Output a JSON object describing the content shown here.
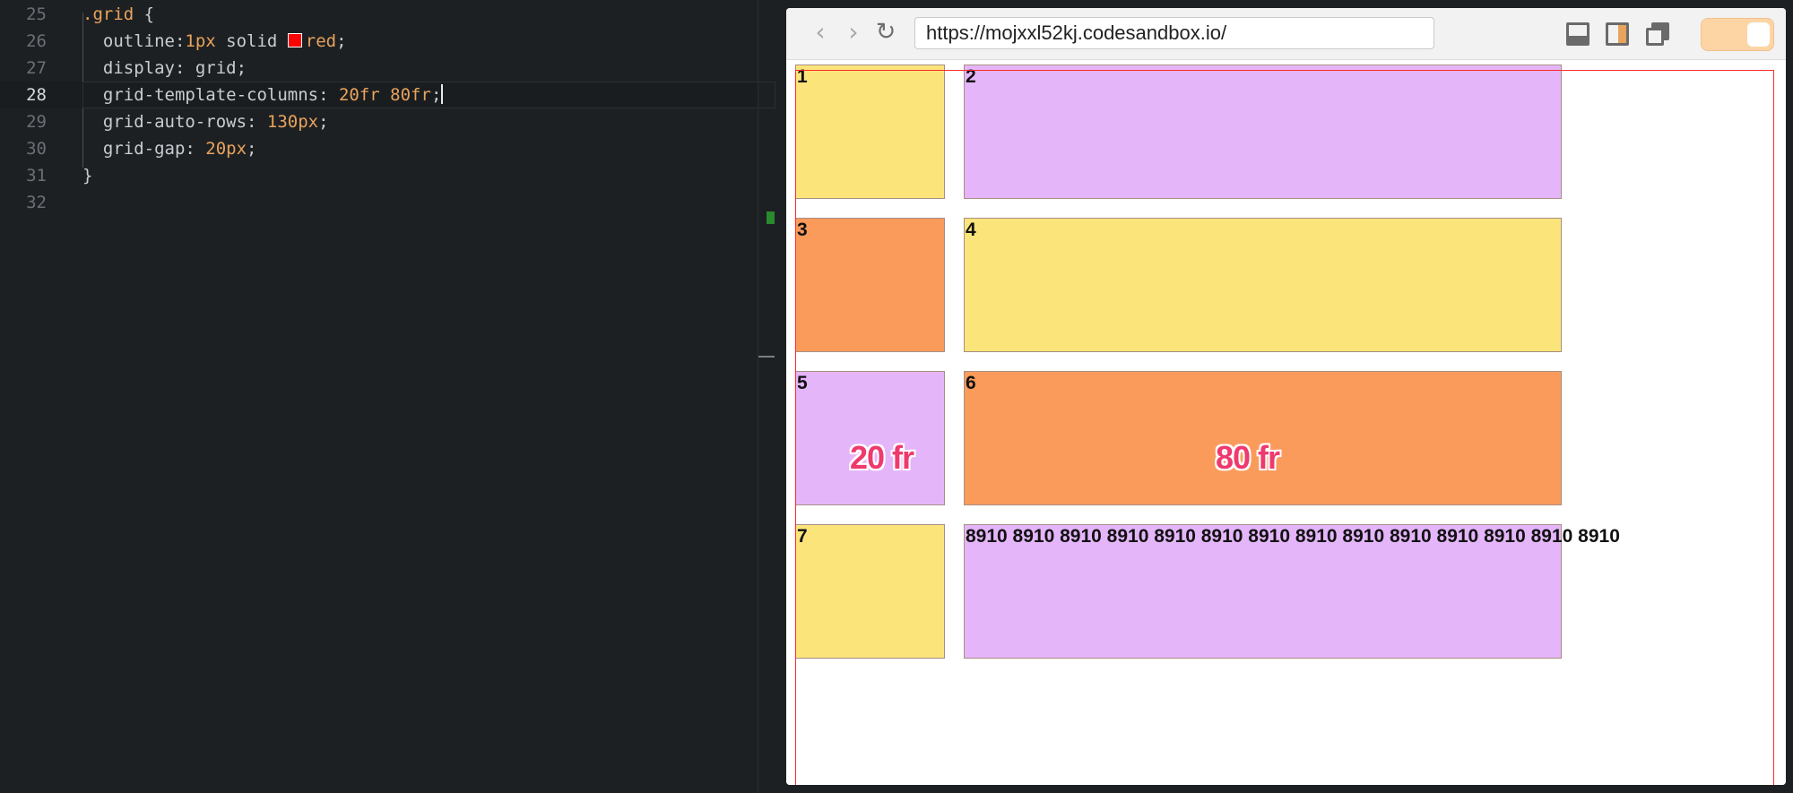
{
  "editor": {
    "lines": [
      {
        "n": "25",
        "parts": [
          {
            "t": ".grid",
            "c": "c-sel"
          },
          {
            "t": " {",
            "c": "c-val"
          }
        ]
      },
      {
        "n": "26",
        "parts": [
          {
            "t": "  outline:",
            "c": "c-prop"
          },
          {
            "t": "1px",
            "c": "c-num"
          },
          {
            "t": " solid ",
            "c": "c-val"
          },
          {
            "t": "__swatch__",
            "c": ""
          },
          {
            "t": "red",
            "c": "c-kw"
          },
          {
            "t": ";",
            "c": "c-val"
          }
        ]
      },
      {
        "n": "27",
        "parts": [
          {
            "t": "  display: grid;",
            "c": "c-prop"
          }
        ]
      },
      {
        "n": "28",
        "parts": [
          {
            "t": "  grid-template-columns: ",
            "c": "c-prop"
          },
          {
            "t": "20fr 80fr",
            "c": "c-num"
          },
          {
            "t": ";",
            "c": "c-val"
          },
          {
            "t": "__caret__",
            "c": ""
          }
        ]
      },
      {
        "n": "29",
        "parts": [
          {
            "t": "  grid-auto-rows: ",
            "c": "c-prop"
          },
          {
            "t": "130px",
            "c": "c-num"
          },
          {
            "t": ";",
            "c": "c-val"
          }
        ]
      },
      {
        "n": "30",
        "parts": [
          {
            "t": "  grid-gap: ",
            "c": "c-prop"
          },
          {
            "t": "20px",
            "c": "c-num"
          },
          {
            "t": ";",
            "c": "c-val"
          }
        ]
      },
      {
        "n": "31",
        "parts": [
          {
            "t": "}",
            "c": "c-val"
          }
        ]
      },
      {
        "n": "32",
        "parts": []
      }
    ],
    "active_line": "28"
  },
  "browser": {
    "url": "https://mojxxl52kj.codesandbox.io/",
    "back_icon": "chevron-left-icon",
    "forward_icon": "chevron-right-icon",
    "reload_icon": "reload-icon"
  },
  "grid": {
    "cells": [
      {
        "label": "1",
        "color": "yellow"
      },
      {
        "label": "2",
        "color": "purple"
      },
      {
        "label": "3",
        "color": "orange"
      },
      {
        "label": "4",
        "color": "yellow"
      },
      {
        "label": "5",
        "color": "purple",
        "big": "20 fr"
      },
      {
        "label": "6",
        "color": "orange",
        "big": "80 fr"
      },
      {
        "label": "7",
        "color": "yellow"
      },
      {
        "label": "8910 8910 8910 8910 8910 8910 8910 8910 8910 8910 8910 8910 8910 8910",
        "color": "purple"
      }
    ]
  }
}
